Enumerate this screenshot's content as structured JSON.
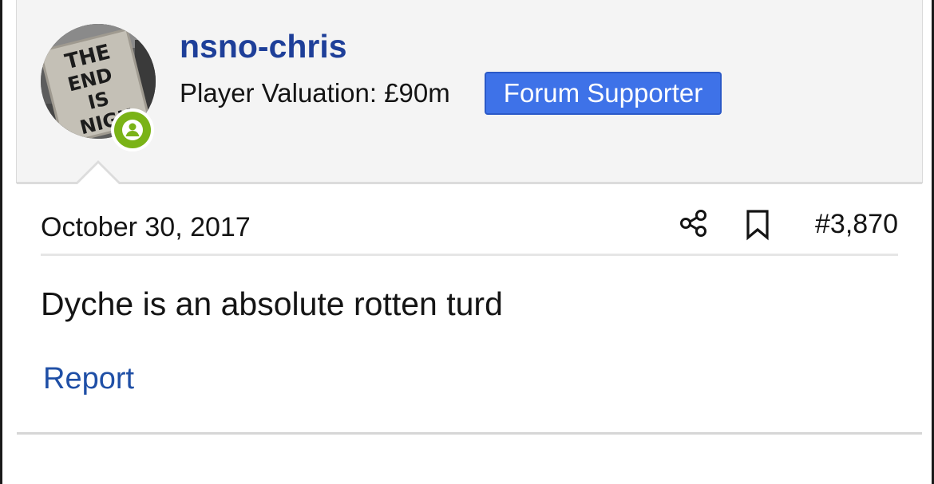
{
  "post": {
    "author": {
      "username": "nsno-chris",
      "valuation_label": "Player Valuation: £90m",
      "badge": "Forum Supporter",
      "online_status": "online",
      "avatar_sign_text": [
        "THE",
        "END",
        "IS",
        "NIGH"
      ]
    },
    "date": "October 30, 2017",
    "post_number": "#3,870",
    "message": "Dyche is an absolute rotten turd",
    "actions": {
      "report_label": "Report",
      "share_icon": "share-icon",
      "bookmark_icon": "bookmark-icon"
    }
  },
  "colors": {
    "username": "#1e3f99",
    "badge_bg": "#3e72e8",
    "online": "#7ab317",
    "link": "#1f4fa6"
  }
}
